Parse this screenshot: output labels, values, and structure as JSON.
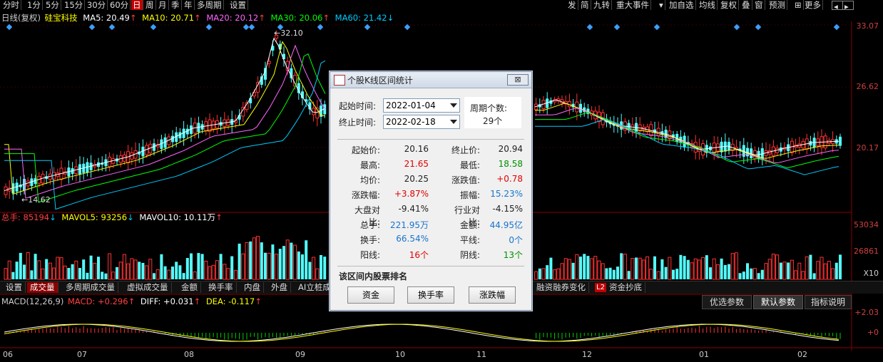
{
  "toolbar": {
    "periods": [
      "分时",
      "1分",
      "5分",
      "15分",
      "30分",
      "60分",
      "日",
      "周",
      "月",
      "季",
      "年",
      "多周期",
      "设置"
    ],
    "active_period": "日",
    "right_items": [
      "发",
      "简",
      "九转",
      "重大事件",
      "加自选",
      "均线",
      "复权",
      "叠",
      "窗",
      "预测",
      "更多"
    ]
  },
  "kline": {
    "title": "日线(复权)",
    "stock": "硅宝科技",
    "ma": [
      {
        "label": "MA5: 20.49",
        "arrow": "↑",
        "color": "#ffffff"
      },
      {
        "label": "MA10: 20.71",
        "arrow": "↑",
        "color": "#ffff00"
      },
      {
        "label": "MA20: 20.12",
        "arrow": "↑",
        "color": "#ff66ff"
      },
      {
        "label": "MA30: 20.06",
        "arrow": "↑",
        "color": "#00ff00"
      },
      {
        "label": "MA60: 21.42",
        "arrow": "↓",
        "color": "#00ccff"
      }
    ],
    "high_mark": "32.10",
    "low_mark": "14.62",
    "axis": [
      "33.07",
      "26.62",
      "20.17"
    ]
  },
  "volume": {
    "label1": "总手: 85194",
    "label2": "MAVOL5: 93256",
    "label3": "MAVOL10: 10.11万",
    "axis": [
      "53034",
      "26861",
      "X10"
    ]
  },
  "tabs": [
    "设置",
    "成交量",
    "多周期成交量",
    "虚拟成交量",
    "金额",
    "换手率",
    "内盘",
    "外盘",
    "AI立桩成",
    "融资融券变化",
    "资金抄底"
  ],
  "tab_badge": "L2",
  "macd": {
    "label": "MACD(12,26,9)",
    "macd_v": "MACD: +0.296",
    "diff_v": "DIFF: +0.031",
    "dea_v": "DEA: -0.117",
    "axis": [
      "+2.03",
      "+0"
    ],
    "buttons": [
      "优选参数",
      "默认参数",
      "指标说明"
    ]
  },
  "months": [
    "06",
    "07",
    "08",
    "09",
    "10",
    "11",
    "12",
    "01",
    "02"
  ],
  "dialog": {
    "title": "个股K线区间统计",
    "close": "⊠",
    "start_label": "起始时间:",
    "start_value": "2022-01-04",
    "end_label": "终止时间:",
    "end_value": "2022-02-18",
    "count_label": "周期个数:",
    "count_value": "29个",
    "stats": [
      [
        "起始价:",
        "20.16",
        "终止价:",
        "20.94"
      ],
      [
        "最高:",
        "21.65",
        "最低:",
        "18.58"
      ],
      [
        "均价:",
        "20.25",
        "涨跌值:",
        "+0.78"
      ],
      [
        "涨跌幅:",
        "+3.87%",
        "振幅:",
        "15.23%"
      ],
      [
        "大盘对比:",
        "-9.41%",
        "行业对比:",
        "-4.15%"
      ],
      [
        "总手:",
        "221.95万",
        "金额:",
        "44.95亿"
      ],
      [
        "换手:",
        "66.54%",
        "平线:",
        "0个"
      ],
      [
        "阳线:",
        "16个",
        "阴线:",
        "13个"
      ]
    ],
    "ranking_title": "该区间内股票排名",
    "buttons": [
      "资金",
      "换手率",
      "涨跌幅"
    ]
  }
}
